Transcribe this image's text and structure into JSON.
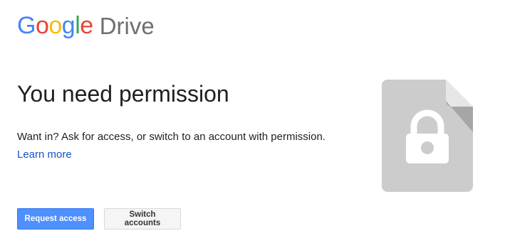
{
  "header": {
    "logo_letters": [
      "G",
      "o",
      "o",
      "g",
      "l",
      "e"
    ],
    "product_name": "Drive"
  },
  "main": {
    "title": "You need permission",
    "message": "Want in? Ask for access, or switch to an account with permission.",
    "learn_more_label": "Learn more"
  },
  "actions": {
    "request_access_label": "Request access",
    "switch_accounts_label": "Switch accounts"
  },
  "icons": {
    "locked_file": "locked-file-icon"
  },
  "colors": {
    "accent": "#4d90fe",
    "link": "#1155cc",
    "icon_gray": "#cccccc",
    "icon_fold": "#a6a6a6"
  }
}
